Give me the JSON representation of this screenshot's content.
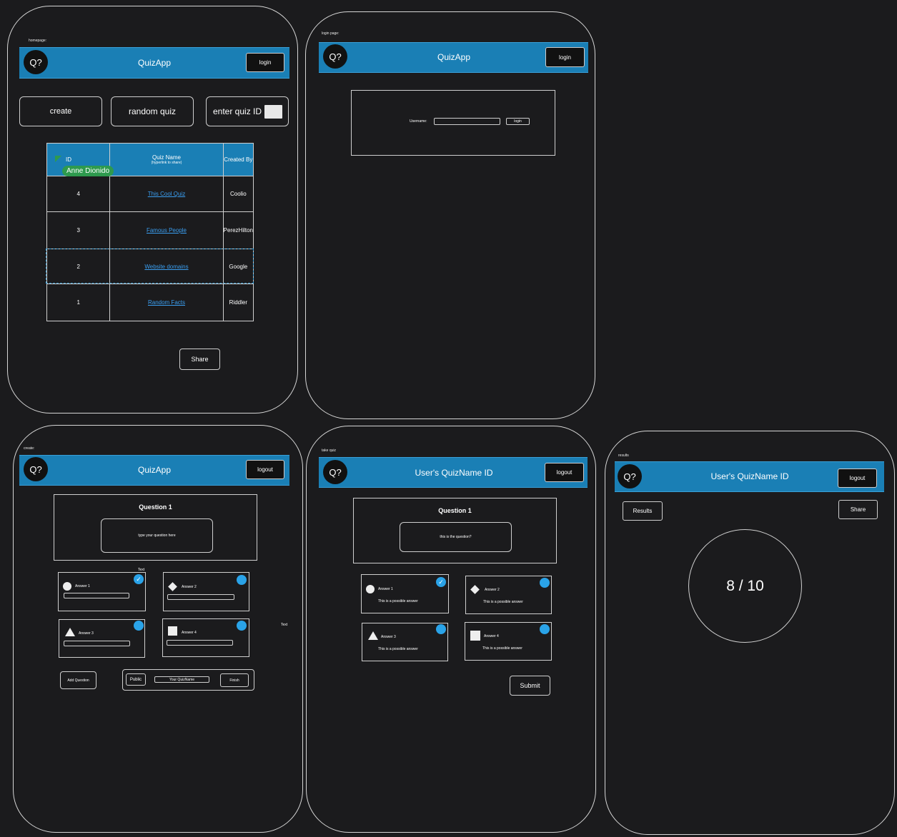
{
  "app_name": "QuizApp",
  "logo_text": "Q?",
  "frames": {
    "homepage": {
      "label": "homepage:",
      "header_button": "login",
      "buttons": {
        "create": "create",
        "random": "random quiz",
        "enter_id": "enter quiz ID"
      },
      "table": {
        "headers": {
          "id": "ID",
          "name": "Quiz Name",
          "name_sub": "(hyperlink to share)",
          "created_by": "Created By"
        },
        "rows": [
          {
            "id": "4",
            "name": "This Cool Quiz",
            "created_by": "Coolio"
          },
          {
            "id": "3",
            "name": "Famous People",
            "created_by": "PerezHilton"
          },
          {
            "id": "2",
            "name": "Website domains",
            "created_by": "Google"
          },
          {
            "id": "1",
            "name": "Random Facts",
            "created_by": "Riddler"
          }
        ]
      },
      "cursor_tag": "Anne Dionido",
      "share_button": "Share"
    },
    "login": {
      "label": "login page:",
      "header_button": "login",
      "username_label": "Username:",
      "login_button": "login"
    },
    "create": {
      "label": "create:",
      "header_button": "logout",
      "question_title": "Question 1",
      "question_placeholder": "type your question here",
      "text_note_1": "Text",
      "text_note_2": "Text",
      "answers": [
        "Answer 1",
        "Answer 2",
        "Answer 3",
        "Answer 4"
      ],
      "add_question": "Add Question",
      "public": "Public",
      "quiz_name": "Your QuizName",
      "finish": "Finish"
    },
    "take": {
      "label": "take quiz",
      "header_title": "User's QuizName ID",
      "header_button": "logout",
      "question_title": "Question 1",
      "question_text": "this is the question?",
      "answers": [
        "Answer 1",
        "Answer 2",
        "Answer 3",
        "Answer 4"
      ],
      "answer_text": "This is a possible answer",
      "submit": "Submit"
    },
    "results": {
      "label": "results",
      "header_title": "User's QuizName ID",
      "header_button": "logout",
      "results_button": "Results",
      "share_button": "Share",
      "score": "8 / 10"
    }
  },
  "colors": {
    "header": "#1a7fb5",
    "accent": "#2aa3e8",
    "link": "#3a9ef0",
    "cursor": "#2e9a4e"
  }
}
